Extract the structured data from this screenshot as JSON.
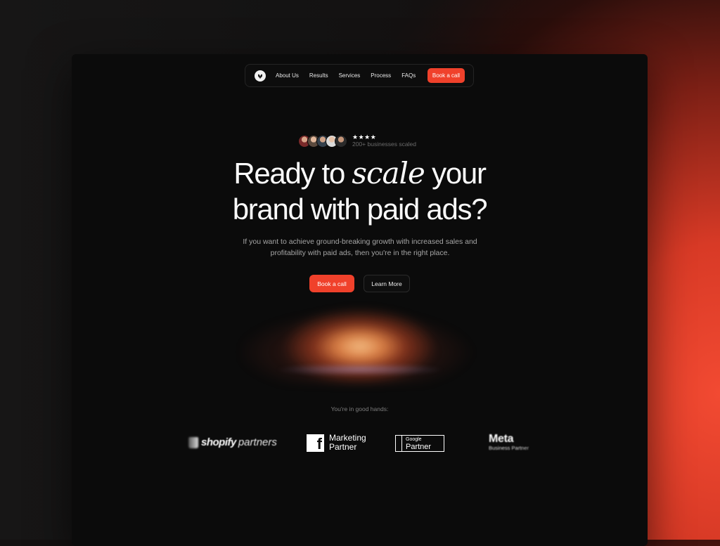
{
  "nav": {
    "links": [
      "About Us",
      "Results",
      "Services",
      "Process",
      "FAQs"
    ],
    "cta_label": "Book a call"
  },
  "social_proof": {
    "stars": "★★★★",
    "label": "200+ businesses scaled"
  },
  "hero": {
    "headline_part1": "Ready to ",
    "headline_accent": "scale",
    "headline_part2": " your",
    "headline_line2": "brand with paid ads?",
    "subtext": "If you want to achieve ground-breaking growth with increased sales and profitability with paid ads, then you're in the right place.",
    "primary_button": "Book a call",
    "secondary_button": "Learn More"
  },
  "partners": {
    "label": "You're in good hands:",
    "shopify_bold": "shopify",
    "shopify_light": "partners",
    "facebook_line1": "Marketing",
    "facebook_line2": "Partner",
    "google_small": "Google",
    "google_big": "Partner",
    "meta_main": "Meta",
    "meta_sub": "Business Partner"
  },
  "colors": {
    "accent": "#f0412b",
    "background": "#0b0b0b",
    "backdrop_glow": "#f24a32"
  },
  "icons": {
    "logo": "leaf-logo-icon",
    "facebook": "facebook-icon",
    "shopify": "shopify-bag-icon"
  }
}
